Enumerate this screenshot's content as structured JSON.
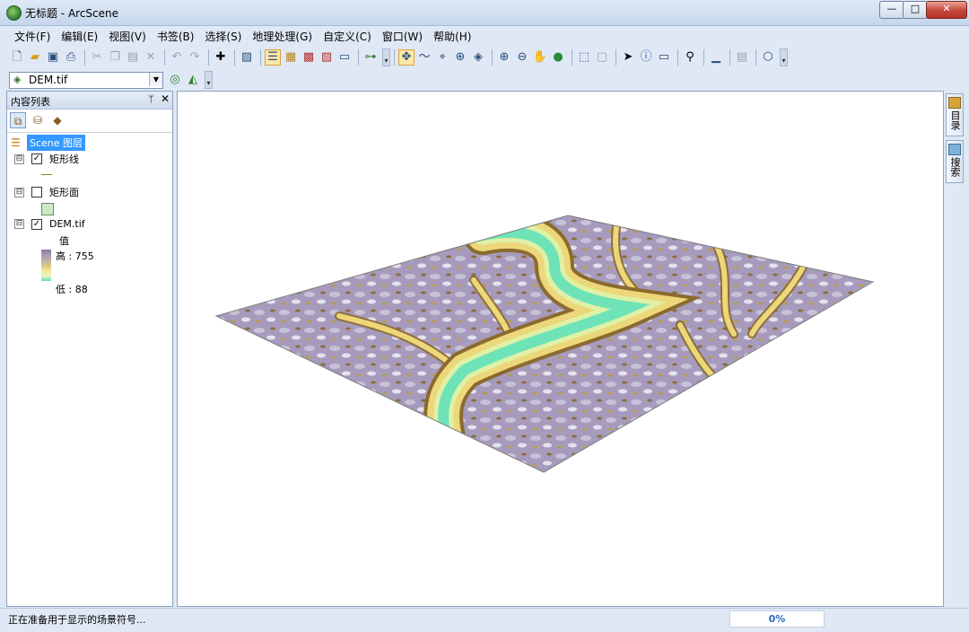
{
  "window": {
    "title": "无标题 - ArcScene",
    "controls": {
      "minimize": "—",
      "maximize": "□",
      "close": "✕"
    }
  },
  "menu": [
    "文件(F)",
    "编辑(E)",
    "视图(V)",
    "书签(B)",
    "选择(S)",
    "地理处理(G)",
    "自定义(C)",
    "窗口(W)",
    "帮助(H)"
  ],
  "toolbar": {
    "icons": [
      "new-document-icon",
      "open-folder-icon",
      "save-icon",
      "print-icon",
      "cut-icon",
      "copy-icon",
      "paste-icon",
      "delete-icon",
      "undo-icon",
      "redo-icon",
      "add-data-icon",
      "image-icon",
      "table-of-contents-icon",
      "catalog-icon",
      "arctoolbox-icon",
      "python-icon",
      "results-icon",
      "model-builder-icon",
      "navigate-icon",
      "fly-icon",
      "target-center-icon",
      "zoom-to-target-icon",
      "set-observer-icon",
      "zoom-in-icon",
      "zoom-out-icon",
      "pan-icon",
      "full-extent-icon",
      "select-features-icon",
      "clear-selection-icon",
      "select-elements-icon",
      "identify-icon",
      "html-popup-icon",
      "find-icon",
      "measure-icon",
      "swipe-icon",
      "3d-effects-icon"
    ]
  },
  "layer_toolbar": {
    "selected_layer": "DEM.tif"
  },
  "toc": {
    "title": "内容列表",
    "pin": "ᛘ",
    "close": "✕",
    "scene_label": "Scene 图层",
    "layers": [
      {
        "name": "矩形线",
        "checked": true,
        "expander": "⊟",
        "check_mark": "✓"
      },
      {
        "name": "矩形面",
        "checked": false,
        "expander": "⊟",
        "check_mark": ""
      },
      {
        "name": "DEM.tif",
        "checked": true,
        "expander": "⊟",
        "check_mark": "✓"
      }
    ],
    "legend": {
      "title": "值",
      "high": "高 : 755",
      "low": "低 : 88"
    }
  },
  "dock": {
    "catalog": "目录",
    "search": "搜索"
  },
  "status": {
    "message": "正在准备用于显示的场景符号...",
    "progress": "0%"
  },
  "colors": {
    "terrain_high": "#9a8fb0",
    "terrain_mid": "#e8d57a",
    "terrain_low": "#6fe3b8",
    "contour_brown": "#8a6a2e",
    "selection_blue": "#3399ff"
  }
}
